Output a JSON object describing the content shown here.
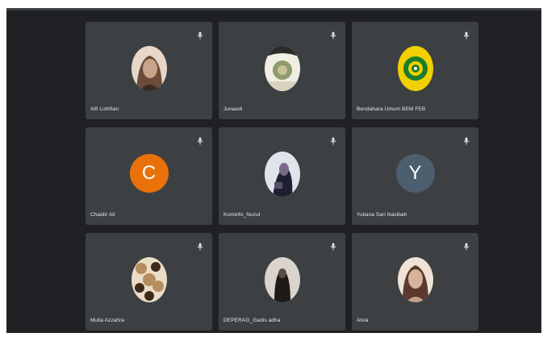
{
  "participants": [
    {
      "name": "Alfi Luthfian",
      "avatar_kind": "photo",
      "colors": [
        "#c9a38a",
        "#6b4b3a",
        "#e8d6c8"
      ]
    },
    {
      "name": "Junaedi",
      "avatar_kind": "photo",
      "colors": [
        "#8f9b6e",
        "#2b2b2b",
        "#f1efe4"
      ]
    },
    {
      "name": "Bendahara Umum BEM FEB",
      "avatar_kind": "logo",
      "colors": [
        "#f2d000",
        "#1a7d2c",
        "#ffffff"
      ]
    },
    {
      "name": "Chaidir Ali",
      "avatar_kind": "letter",
      "initial": "C",
      "colors": [
        "#e8710a"
      ]
    },
    {
      "name": "Kominfo_Nuzul",
      "avatar_kind": "photo",
      "colors": [
        "#dfe3ea",
        "#1d2030",
        "#7a6a8a"
      ]
    },
    {
      "name": "Yuliana Sari Nasibah",
      "avatar_kind": "letter",
      "initial": "Y",
      "colors": [
        "#4d5e6e"
      ]
    },
    {
      "name": "Mulia Azzahra",
      "avatar_kind": "photo",
      "colors": [
        "#b68d5f",
        "#3d2a19",
        "#eadcc6"
      ]
    },
    {
      "name": "DEPERAG_Gadis adha",
      "avatar_kind": "photo",
      "colors": [
        "#d9d4cc",
        "#1e1a18",
        "#5a4b45"
      ]
    },
    {
      "name": "Alvia",
      "avatar_kind": "photo",
      "colors": [
        "#d8b39b",
        "#5b3a2d",
        "#f0e2d6"
      ]
    }
  ],
  "icons": {
    "mic": "mic-off-icon"
  }
}
